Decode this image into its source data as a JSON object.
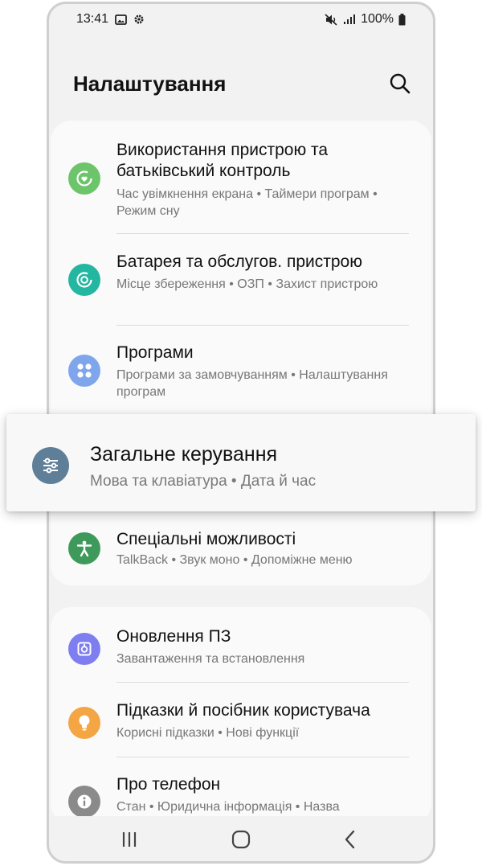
{
  "status_bar": {
    "time": "13:41",
    "battery": "100%"
  },
  "header": {
    "title": "Налаштування"
  },
  "settings": [
    {
      "title": "Використання пристрою та батьківський контроль",
      "subtitle": "Час увімкнення екрана • Таймери програм • Режим сну",
      "icon": "digital-wellbeing-icon",
      "color": "#6cc56b"
    },
    {
      "title": "Батарея та обслугов. пристрою",
      "subtitle": "Місце збереження • ОЗП • Захист пристрою",
      "icon": "device-care-icon",
      "color": "#23b6a0"
    },
    {
      "title": "Програми",
      "subtitle": "Програми за замовчуванням • Налаштування програм",
      "icon": "apps-icon",
      "color": "#7fa6ec"
    },
    {
      "title": "Загальне керування",
      "subtitle": "Мова та клавіатура • Дата й час",
      "icon": "general-management-icon",
      "color": "#5f7f99"
    },
    {
      "title": "Спеціальні можливості",
      "subtitle": "TalkBack • Звук моно • Допоміжне меню",
      "icon": "accessibility-icon",
      "color": "#3d9a5a"
    },
    {
      "title": "Оновлення ПЗ",
      "subtitle": "Завантаження та встановлення",
      "icon": "software-update-icon",
      "color": "#7e7ef0"
    },
    {
      "title": "Підказки й посібник користувача",
      "subtitle": "Корисні підказки • Нові функції",
      "icon": "tips-icon",
      "color": "#f4a544"
    },
    {
      "title": "Про телефон",
      "subtitle": "Стан • Юридична інформація • Назва",
      "icon": "about-phone-icon",
      "color": "#8a8a8a"
    }
  ]
}
